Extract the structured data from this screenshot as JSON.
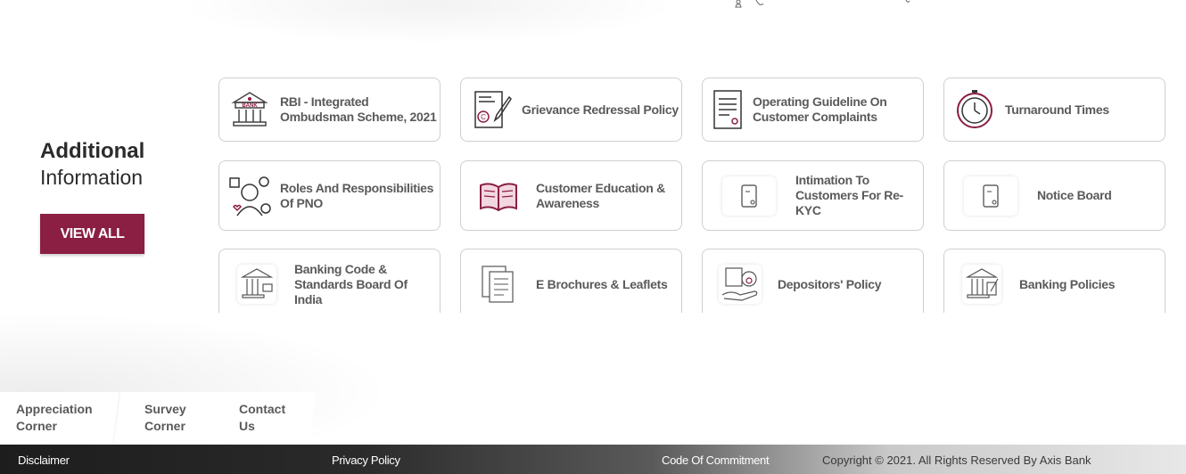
{
  "additional_info": {
    "title": "Additional",
    "subtitle": "Information",
    "view_all_label": "VIEW ALL"
  },
  "cards": [
    {
      "label": "RBI - Integrated Ombudsman Scheme, 2021",
      "icon": "bank-building-icon"
    },
    {
      "label": "Grievance Redressal Policy",
      "icon": "policy-document-pen-icon"
    },
    {
      "label": "Operating Guideline On Customer Complaints",
      "icon": "guideline-document-icon"
    },
    {
      "label": "Turnaround Times",
      "icon": "clock-icon"
    },
    {
      "label": "Roles And Responsibilities Of PNO",
      "icon": "person-officer-icon"
    },
    {
      "label": "Customer Education & Awareness",
      "icon": "open-book-icon"
    },
    {
      "label": "Intimation To Customers For Re-KYC",
      "icon": "kyc-document-icon"
    },
    {
      "label": "Notice Board",
      "icon": "notice-document-icon"
    },
    {
      "label": "Banking Code & Standards Board Of India",
      "icon": "bank-pillars-icon"
    },
    {
      "label": "E Brochures & Leaflets",
      "icon": "brochures-icon"
    },
    {
      "label": "Depositors' Policy",
      "icon": "money-hand-icon"
    },
    {
      "label": "Banking Policies",
      "icon": "bank-policy-icon"
    }
  ],
  "footer_tabs": [
    "Appreciation Corner",
    "Survey Corner",
    "Contact Us"
  ],
  "bottom_links": [
    "Disclaimer",
    "Privacy Policy",
    "Code Of Commitment"
  ],
  "copyright": "Copyright © 2021. All Rights Reserved By Axis Bank",
  "colors": {
    "brand": "#8a1f43"
  }
}
